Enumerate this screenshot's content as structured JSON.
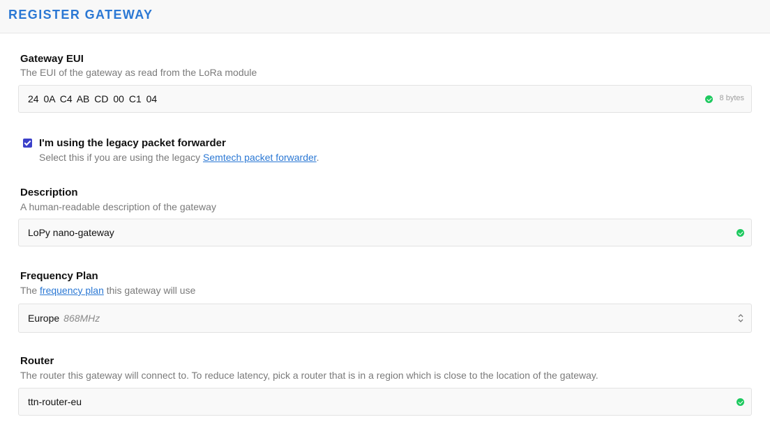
{
  "header": {
    "title": "REGISTER GATEWAY"
  },
  "gateway_eui": {
    "label": "Gateway EUI",
    "help": "The EUI of the gateway as read from the LoRa module",
    "value": "24 0A C4 AB CD 00 C1 04",
    "byte_count": "8 bytes",
    "status_icon": "check-circle-icon",
    "status_color": "#1ec95f"
  },
  "legacy_forwarder": {
    "checked": true,
    "label": "I'm using the legacy packet forwarder",
    "help_prefix": "Select this if you are using the legacy ",
    "help_link": "Semtech packet forwarder",
    "help_suffix": ".",
    "checkbox_color": "#3b40c9"
  },
  "description": {
    "label": "Description",
    "help": "A human-readable description of the gateway",
    "value": "LoPy nano-gateway",
    "status_icon": "check-circle-icon"
  },
  "frequency_plan": {
    "label": "Frequency Plan",
    "help_prefix": "The ",
    "help_link": "frequency plan",
    "help_suffix": " this gateway will use",
    "selected_value": "Europe",
    "selected_unit": "868MHz",
    "arrow_icon": "select-arrows-icon"
  },
  "router": {
    "label": "Router",
    "help": "The router this gateway will connect to. To reduce latency, pick a router that is in a region which is close to the location of the gateway.",
    "value": "ttn-router-eu",
    "status_icon": "check-circle-icon"
  },
  "colors": {
    "accent": "#2b78d4",
    "success": "#1ec95f"
  }
}
